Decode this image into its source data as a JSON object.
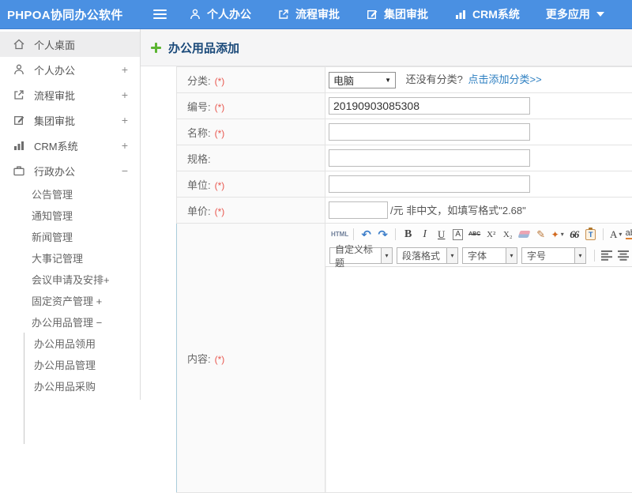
{
  "colors": {
    "header_blue": "#4a90e2",
    "link_blue": "#2d7fc1",
    "title_navy": "#1b4a7a",
    "required_red": "#e8564e",
    "plus_green": "#5cb532"
  },
  "header": {
    "logo": "PHPOA协同办公软件",
    "nav": [
      {
        "label": "个人办公",
        "icon": "person-icon"
      },
      {
        "label": "流程审批",
        "icon": "flow-icon"
      },
      {
        "label": "集团审批",
        "icon": "edit-icon"
      },
      {
        "label": "CRM系统",
        "icon": "chart-icon"
      },
      {
        "label": "更多应用",
        "icon": "caret-down-icon"
      }
    ]
  },
  "sidebar": {
    "items": [
      {
        "label": "个人桌面",
        "expand": "",
        "icon": "home-icon"
      },
      {
        "label": "个人办公",
        "expand": "+",
        "icon": "person-icon"
      },
      {
        "label": "流程审批",
        "expand": "+",
        "icon": "flow-icon"
      },
      {
        "label": "集团审批",
        "expand": "+",
        "icon": "edit-icon"
      },
      {
        "label": "CRM系统",
        "expand": "+",
        "icon": "chart-icon"
      },
      {
        "label": "行政办公",
        "expand": "−",
        "icon": "briefcase-icon"
      }
    ],
    "admin_items": [
      {
        "label": "公告管理"
      },
      {
        "label": "通知管理"
      },
      {
        "label": "新闻管理"
      },
      {
        "label": "大事记管理"
      },
      {
        "label": "会议申请及安排+"
      },
      {
        "label": "固定资产管理 +"
      },
      {
        "label": "办公用品管理 −"
      }
    ],
    "supplies_items": [
      {
        "label": "办公用品领用"
      },
      {
        "label": "办公用品管理"
      },
      {
        "label": "办公用品采购"
      }
    ]
  },
  "main": {
    "title": "办公用品添加",
    "form": {
      "category": {
        "label": "分类:",
        "required": "(*)",
        "value": "电脑",
        "arrow": "▼",
        "hint": "还没有分类?",
        "link": "点击添加分类>>"
      },
      "code": {
        "label": "编号:",
        "required": "(*)",
        "value": "20190903085308"
      },
      "name": {
        "label": "名称:",
        "required": "(*)",
        "value": ""
      },
      "spec": {
        "label": "规格:",
        "value": ""
      },
      "unit": {
        "label": "单位:",
        "required": "(*)",
        "value": ""
      },
      "price": {
        "label": "单价:",
        "required": "(*)",
        "value": "",
        "suffix": "/元 非中文，如填写格式\"2.68\""
      },
      "content": {
        "label": "内容:",
        "required": "(*)"
      }
    },
    "editor": {
      "t1": {
        "html": "HTML",
        "undo": "↶",
        "redo": "↷",
        "bold": "B",
        "italic": "I",
        "underline": "U",
        "fontname": "A",
        "strike": "ABC",
        "sup": "X²",
        "sub": "X₂",
        "brush": "✎",
        "paint": "✦",
        "quote": "66",
        "paste": "T",
        "forecolor": "A",
        "hilite": "ab",
        "caret": "▾"
      },
      "t2": {
        "d1": "自定义标题",
        "d2": "段落格式",
        "d3": "字体",
        "d4": "字号",
        "link": "∞"
      }
    }
  }
}
